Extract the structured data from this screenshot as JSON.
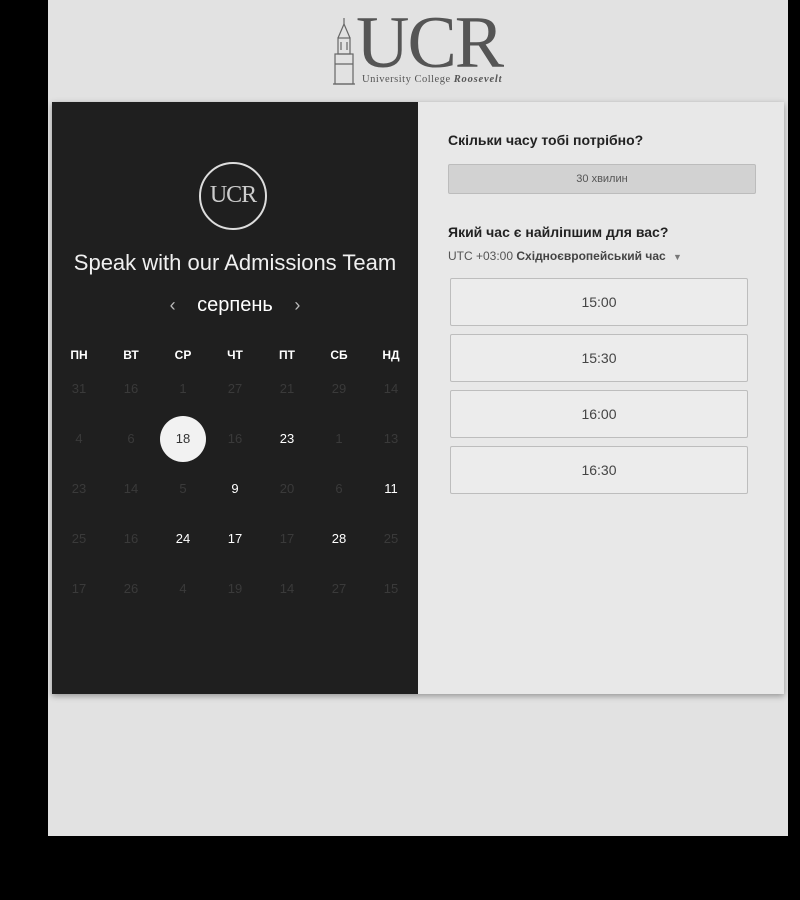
{
  "logo": {
    "mark": "UCR",
    "subtitle_plain": "University College ",
    "subtitle_emph": "Roosevelt"
  },
  "panel": {
    "badge": "UCR",
    "headline": "Speak with our Admissions Team",
    "month": "серпень",
    "prev_arrow": "‹",
    "next_arrow": "›",
    "weekdays": [
      "ПН",
      "ВТ",
      "СР",
      "ЧТ",
      "ПТ",
      "СБ",
      "НД"
    ],
    "weeks": [
      [
        {
          "d": "31",
          "available": false
        },
        {
          "d": "16",
          "available": false
        },
        {
          "d": "1",
          "available": false
        },
        {
          "d": "27",
          "available": false
        },
        {
          "d": "21",
          "available": false
        },
        {
          "d": "29",
          "available": false
        },
        {
          "d": "14",
          "available": false
        }
      ],
      [
        {
          "d": "4",
          "available": false
        },
        {
          "d": "6",
          "available": false
        },
        {
          "d": "18",
          "available": true,
          "selected": true
        },
        {
          "d": "16",
          "available": false
        },
        {
          "d": "23",
          "available": true
        },
        {
          "d": "1",
          "available": false
        },
        {
          "d": "13",
          "available": false
        }
      ],
      [
        {
          "d": "23",
          "available": false
        },
        {
          "d": "14",
          "available": false
        },
        {
          "d": "5",
          "available": false
        },
        {
          "d": "9",
          "available": true
        },
        {
          "d": "20",
          "available": false
        },
        {
          "d": "6",
          "available": false
        },
        {
          "d": "11",
          "available": true
        }
      ],
      [
        {
          "d": "25",
          "available": false
        },
        {
          "d": "16",
          "available": false
        },
        {
          "d": "24",
          "available": true
        },
        {
          "d": "17",
          "available": true
        },
        {
          "d": "17",
          "available": false
        },
        {
          "d": "28",
          "available": true
        },
        {
          "d": "25",
          "available": false
        }
      ],
      [
        {
          "d": "17",
          "available": false
        },
        {
          "d": "26",
          "available": false
        },
        {
          "d": "4",
          "available": false
        },
        {
          "d": "19",
          "available": false
        },
        {
          "d": "14",
          "available": false
        },
        {
          "d": "27",
          "available": false
        },
        {
          "d": "15",
          "available": false
        }
      ]
    ]
  },
  "booking": {
    "duration_question": "Скільки часу тобі потрібно?",
    "duration_value": "30 хвилин",
    "time_question": "Який час є найліпшим для вас?",
    "timezone_offset": "UTC +03:00",
    "timezone_name": "Східноєвропейський час",
    "slots": [
      "15:00",
      "15:30",
      "16:00",
      "16:30"
    ]
  }
}
